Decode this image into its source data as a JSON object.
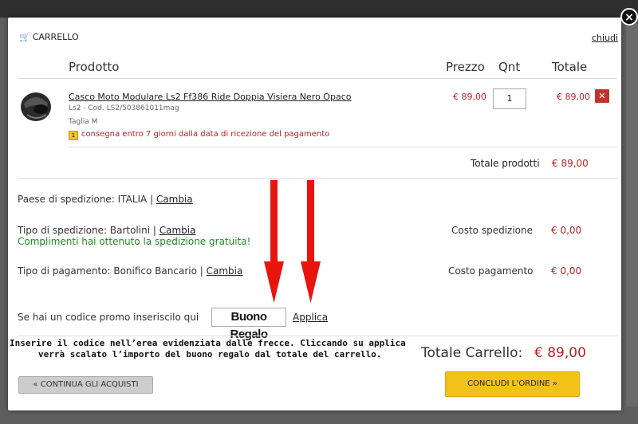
{
  "cart": {
    "title": "CARRELLO",
    "close_link": "chiudi",
    "close_icon": "×",
    "columns": {
      "product": "Prodotto",
      "price": "Prezzo",
      "qty": "Qnt",
      "total": "Totale"
    },
    "item": {
      "name": "Casco Moto Modulare Ls2 Ff386 Ride Doppia Visiera Nero Opaco",
      "code": "Ls2 - Cod. LS2/503861011mag",
      "size": "Taglia M",
      "delivery": "consegna entro 7 giorni dalla data di ricezione del pagamento",
      "price": "€ 89,00",
      "qty": "1",
      "total": "€ 89,00",
      "remove_icon": "✕"
    },
    "products_total_label": "Totale prodotti",
    "products_total_value": "€ 89,00"
  },
  "shipping": {
    "country_label": "Paese di spedizione: ITALIA |",
    "country_change": "Cambia",
    "type_label": "Tipo di spedizione: Bartolini |",
    "type_change": "Cambia",
    "free_message": "Complimenti hai ottenuto la spedizione gratuita!",
    "cost_label": "Costo spedizione",
    "cost_value": "€ 0,00"
  },
  "payment": {
    "type_label": "Tipo di pagamento: Bonifico Bancario |",
    "type_change": "Cambia",
    "cost_label": "Costo pagamento",
    "cost_value": "€ 0,00"
  },
  "promo": {
    "label": "Se hai un codice promo inseriscilo qui",
    "value": "Buono Regalo",
    "apply": "Applica"
  },
  "annotation": {
    "line1": "Inserire il codice nell’erea evidenziata dalle frecce. Cliccando su applica",
    "line2": "verrà scalato l’importo del buono regalo dal totale del carrello.",
    "arrow_color": "#e8140e"
  },
  "summary": {
    "total_label": "Totale Carrello:",
    "total_value": "€ 89,00"
  },
  "buttons": {
    "continue": "« CONTINUA GLI ACQUISTI",
    "checkout": "CONCLUDI L’ORDINE »"
  },
  "colors": {
    "accent_red": "#b42323",
    "success_green": "#1e8c1e",
    "checkout_yellow": "#f2c219"
  }
}
